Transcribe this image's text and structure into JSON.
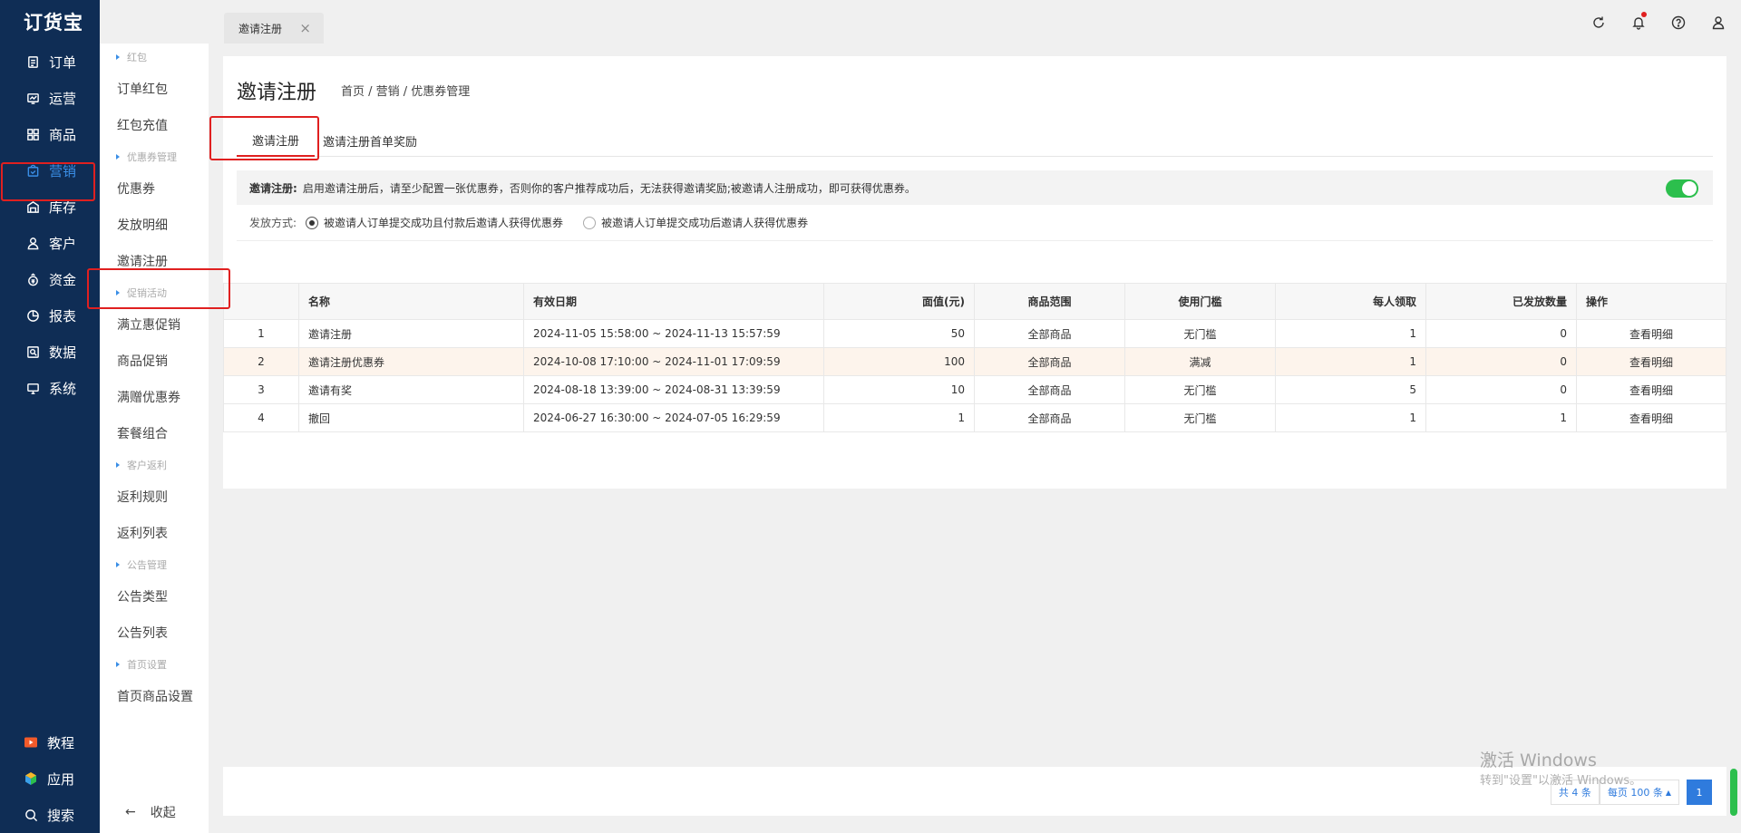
{
  "app": {
    "logo": "订货宝"
  },
  "mainnav": {
    "items": [
      {
        "label": "订单",
        "icon": "order-icon"
      },
      {
        "label": "运营",
        "icon": "operation-icon"
      },
      {
        "label": "商品",
        "icon": "goods-icon"
      },
      {
        "label": "营销",
        "icon": "marketing-icon",
        "active": true
      },
      {
        "label": "库存",
        "icon": "warehouse-icon"
      },
      {
        "label": "客户",
        "icon": "customer-icon"
      },
      {
        "label": "资金",
        "icon": "funds-icon"
      },
      {
        "label": "报表",
        "icon": "report-icon"
      },
      {
        "label": "数据",
        "icon": "data-icon"
      },
      {
        "label": "系统",
        "icon": "system-icon"
      }
    ],
    "bottom": [
      {
        "label": "教程",
        "icon": "tutorial-icon"
      },
      {
        "label": "应用",
        "icon": "apps-icon"
      },
      {
        "label": "搜索",
        "icon": "search-icon"
      }
    ]
  },
  "subnav": {
    "groups": [
      {
        "title": "红包",
        "items": [
          "订单红包",
          "红包充值"
        ]
      },
      {
        "title": "优惠券管理",
        "items": [
          "优惠券",
          "发放明细",
          "邀请注册"
        ]
      },
      {
        "title": "促销活动",
        "items": [
          "满立惠促销",
          "商品促销",
          "满赠优惠券",
          "套餐组合"
        ]
      },
      {
        "title": "客户返利",
        "items": [
          "返利规则",
          "返利列表"
        ]
      },
      {
        "title": "公告管理",
        "items": [
          "公告类型",
          "公告列表"
        ]
      },
      {
        "title": "首页设置",
        "items": [
          "首页商品设置"
        ]
      }
    ],
    "collapse_label": "收起",
    "collapse_arrow": "←"
  },
  "topbar": {
    "tab_label": "邀请注册",
    "close_glyph": "×",
    "icons": [
      "refresh-icon",
      "bell-icon",
      "help-icon",
      "user-icon"
    ]
  },
  "page": {
    "title": "邀请注册",
    "breadcrumb": "首页 / 营销 / 优惠券管理",
    "tabs": [
      "邀请注册",
      "邀请注册首单奖励"
    ],
    "notice_label": "邀请注册:",
    "notice_text": "启用邀请注册后，请至少配置一张优惠券，否则你的客户推荐成功后，无法获得邀请奖励;被邀请人注册成功，即可获得优惠券。",
    "toggle_on": true,
    "method_label": "发放方式:",
    "methods": [
      {
        "label": "被邀请人订单提交成功且付款后邀请人获得优惠券",
        "checked": true
      },
      {
        "label": "被邀请人订单提交成功后邀请人获得优惠券",
        "checked": false
      }
    ]
  },
  "table": {
    "headers": [
      "",
      "名称",
      "有效日期",
      "面值(元)",
      "商品范围",
      "使用门槛",
      "每人领取",
      "已发放数量",
      "操作"
    ],
    "rows": [
      [
        "1",
        "邀请注册",
        "2024-11-05 15:58:00 ~ 2024-11-13 15:57:59",
        "50",
        "全部商品",
        "无门槛",
        "1",
        "0",
        "查看明细"
      ],
      [
        "2",
        "邀请注册优惠券",
        "2024-10-08 17:10:00 ~ 2024-11-01 17:09:59",
        "100",
        "全部商品",
        "满减",
        "1",
        "0",
        "查看明细"
      ],
      [
        "3",
        "邀请有奖",
        "2024-08-18 13:39:00 ~ 2024-08-31 13:39:59",
        "10",
        "全部商品",
        "无门槛",
        "5",
        "0",
        "查看明细"
      ],
      [
        "4",
        "撤回",
        "2024-06-27 16:30:00 ~ 2024-07-05 16:29:59",
        "1",
        "全部商品",
        "无门槛",
        "1",
        "1",
        "查看明细"
      ]
    ],
    "highlight_row": 1
  },
  "pager": {
    "total": "共 4 条",
    "per_page": "每页 100 条",
    "current": "1"
  },
  "watermark": {
    "line1": "激活 Windows",
    "line2": "转到\"设置\"以激活 Windows。"
  },
  "colors": {
    "nav_bg": "#0f2d55",
    "accent": "#3a8ee6",
    "highlight": "#e02020",
    "toggle": "#2cbf4d"
  }
}
